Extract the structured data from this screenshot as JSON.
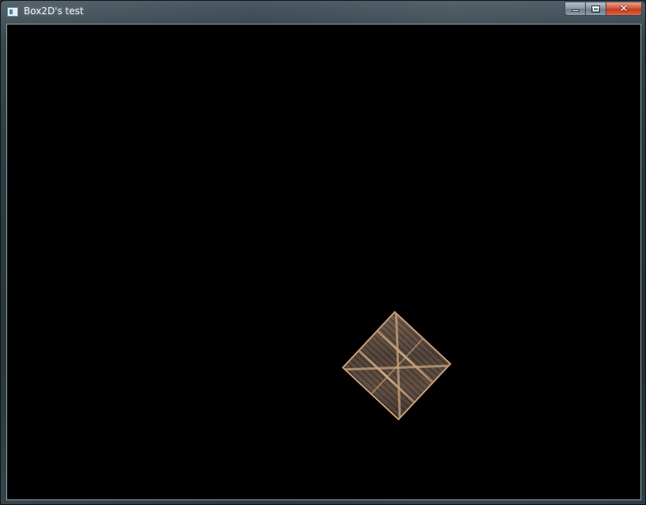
{
  "window": {
    "title": "Box2D's test",
    "accent_color": "#c23a1a",
    "icons": [
      "app-icon",
      "minimize-icon",
      "maximize-icon",
      "close-icon"
    ]
  },
  "titlebar": {
    "close_glyph": "✕"
  },
  "scene": {
    "background_color": "#000000",
    "objects": [
      {
        "type": "crate",
        "shape": "box",
        "rotation_deg": 43
      }
    ]
  }
}
